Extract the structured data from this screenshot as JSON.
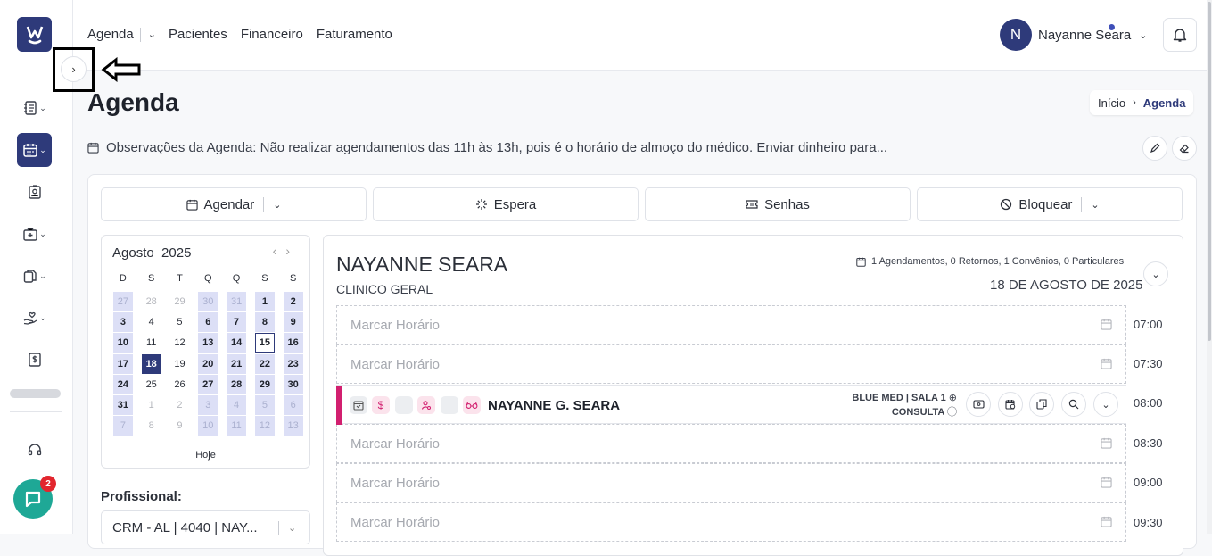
{
  "sidebar": {
    "logo_text": "W",
    "chat_badge": "2"
  },
  "topnav": {
    "agenda": "Agenda",
    "pacientes": "Pacientes",
    "financeiro": "Financeiro",
    "faturamento": "Faturamento"
  },
  "user": {
    "initial": "N",
    "name": "Nayanne Seara"
  },
  "page": {
    "title": "Agenda",
    "breadcrumb_home": "Início",
    "breadcrumb_current": "Agenda",
    "observations": "Observações da Agenda: Não realizar agendamentos das 11h às 13h, pois é o horário de almoço do médico. Enviar dinheiro para..."
  },
  "actions": {
    "agendar": "Agendar",
    "espera": "Espera",
    "senhas": "Senhas",
    "bloquear": "Bloquear"
  },
  "calendar": {
    "month": "Agosto",
    "year": "2025",
    "weekdays": [
      "D",
      "S",
      "T",
      "Q",
      "Q",
      "S",
      "S"
    ],
    "today_label": "Hoje",
    "weeks": [
      [
        "27",
        "28",
        "29",
        "30",
        "31",
        "1",
        "2"
      ],
      [
        "3",
        "4",
        "5",
        "6",
        "7",
        "8",
        "9"
      ],
      [
        "10",
        "11",
        "12",
        "13",
        "14",
        "15",
        "16"
      ],
      [
        "17",
        "18",
        "19",
        "20",
        "21",
        "22",
        "23"
      ],
      [
        "24",
        "25",
        "26",
        "27",
        "28",
        "29",
        "30"
      ],
      [
        "31",
        "1",
        "2",
        "3",
        "4",
        "5",
        "6"
      ],
      [
        "7",
        "8",
        "9",
        "10",
        "11",
        "12",
        "13"
      ]
    ]
  },
  "professional": {
    "label": "Profissional:",
    "value": "CRM - AL | 4040 | NAY..."
  },
  "schedule": {
    "doctor_name": "NAYANNE SEARA",
    "specialty": "CLINICO GERAL",
    "stats": "1 Agendamentos, 0 Retornos, 1 Convênios, 0 Particulares",
    "date": "18 DE AGOSTO DE 2025",
    "empty_label": "Marcar Horário",
    "times": [
      "07:00",
      "07:30",
      "08:00",
      "08:30",
      "09:00",
      "09:30"
    ],
    "appointment": {
      "patient": "NAYANNE G. SEARA",
      "insurance": "BLUE MED | SALA 1",
      "type": "CONSULTA"
    }
  }
}
